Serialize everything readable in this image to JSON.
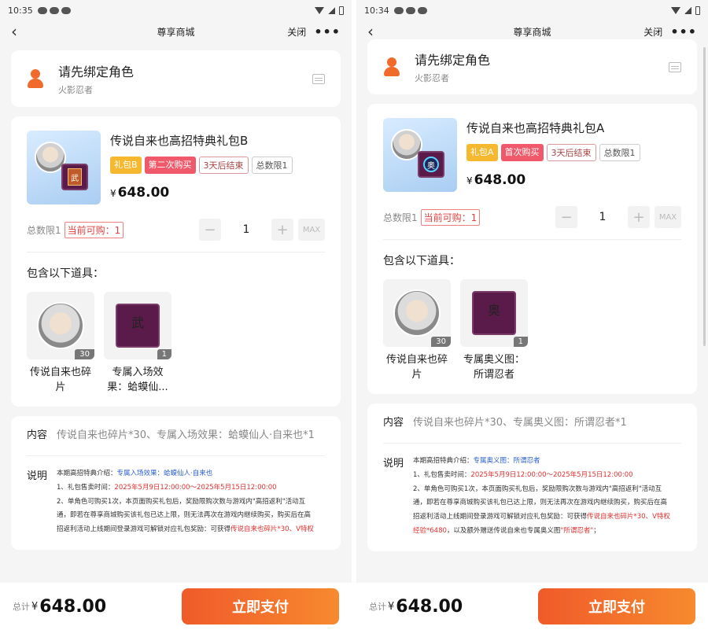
{
  "left": {
    "status": {
      "time": "10:35"
    },
    "nav": {
      "title": "尊享商城",
      "close": "关闭",
      "more": "•••"
    },
    "bind": {
      "title": "请先绑定角色",
      "subtitle": "火影忍者"
    },
    "product": {
      "name": "传说自来也高招特典礼包B",
      "tags": [
        "礼包B",
        "第二次购买",
        "3天后结束",
        "总数限1"
      ],
      "price_symbol": "¥",
      "price": "648.00",
      "limit": "总数限1",
      "can_buy": "当前可购：1",
      "quantity": "1",
      "minus": "−",
      "plus": "+",
      "max": "MAX"
    },
    "includes_title": "包含以下道具：",
    "items": [
      {
        "name": "传说自来也碎片",
        "count": "30"
      },
      {
        "name": "专属入场效果：蛤蟆仙...",
        "count": "1",
        "glyph": "武"
      }
    ],
    "content": {
      "label": "内容",
      "value": "传说自来也碎片*30、专属入场效果：蛤蟆仙人·自来也*1"
    },
    "explain": {
      "label": "说明",
      "l1a": "本期高招特典介绍：",
      "l1b": "专属入场效果：蛤蟆仙人·自来也",
      "l2a": "1、礼包售卖时间：",
      "l2b": "2025年5月9日12:00:00～2025年5月15日12:00:00",
      "l3": "2、单角色可购买1次，本页面购买礼包后，奖励限购次数与游戏内\"高招返利\"活动互",
      "l4": "通，即若在尊享商城购买该礼包已达上限，则无法再次在游戏内继续购买，购买后在高",
      "l5a": "招返利活动上线期间登录游戏可解锁对应礼包奖励：可获得",
      "l5b": "传说自来也碎片*30、V特权"
    },
    "footer": {
      "total_label": "总计",
      "symbol": "¥",
      "total": "648.00",
      "pay": "立即支付"
    }
  },
  "right": {
    "status": {
      "time": "10:34"
    },
    "nav": {
      "title": "尊享商城",
      "close": "关闭",
      "more": "•••"
    },
    "bind": {
      "title": "请先绑定角色",
      "subtitle": "火影忍者"
    },
    "product": {
      "name": "传说自来也高招特典礼包A",
      "tags": [
        "礼包A",
        "首次购买",
        "3天后结束",
        "总数限1"
      ],
      "price_symbol": "¥",
      "price": "648.00",
      "limit": "总数限1",
      "can_buy": "当前可购：1",
      "quantity": "1",
      "minus": "−",
      "plus": "+",
      "max": "MAX"
    },
    "includes_title": "包含以下道具：",
    "items": [
      {
        "name": "传说自来也碎片",
        "count": "30"
      },
      {
        "name": "专属奥义图：所谓忍者",
        "count": "1",
        "glyph": "奥"
      }
    ],
    "content": {
      "label": "内容",
      "value": "传说自来也碎片*30、专属奥义图：所谓忍者*1"
    },
    "explain": {
      "label": "说明",
      "l1a": "本期高招特典介绍：",
      "l1b": "专属奥义图：所谓忍者",
      "l2a": "1、礼包售卖时间：",
      "l2b": "2025年5月9日12:00:00～2025年5月15日12:00:00",
      "l3": "2、单角色可购买1次，本页面购买礼包后，奖励限购次数与游戏内\"高招返利\"活动互",
      "l4": "通，即若在尊享商城购买该礼包已达上限，则无法再次在游戏内继续购买，购买后在高",
      "l5a": "招返利活动上线期间登录游戏可解锁对应礼包奖励：可获得",
      "l5b": "传说自来也碎片*30、V特权",
      "l6a": "经验*6480",
      "l6b": "，以及额外赠送传说自来也专属奥义图",
      "l6c": "\"所谓忍者\"",
      "l6d": "；"
    },
    "footer": {
      "total_label": "总计",
      "symbol": "¥",
      "total": "648.00",
      "pay": "立即支付"
    }
  }
}
